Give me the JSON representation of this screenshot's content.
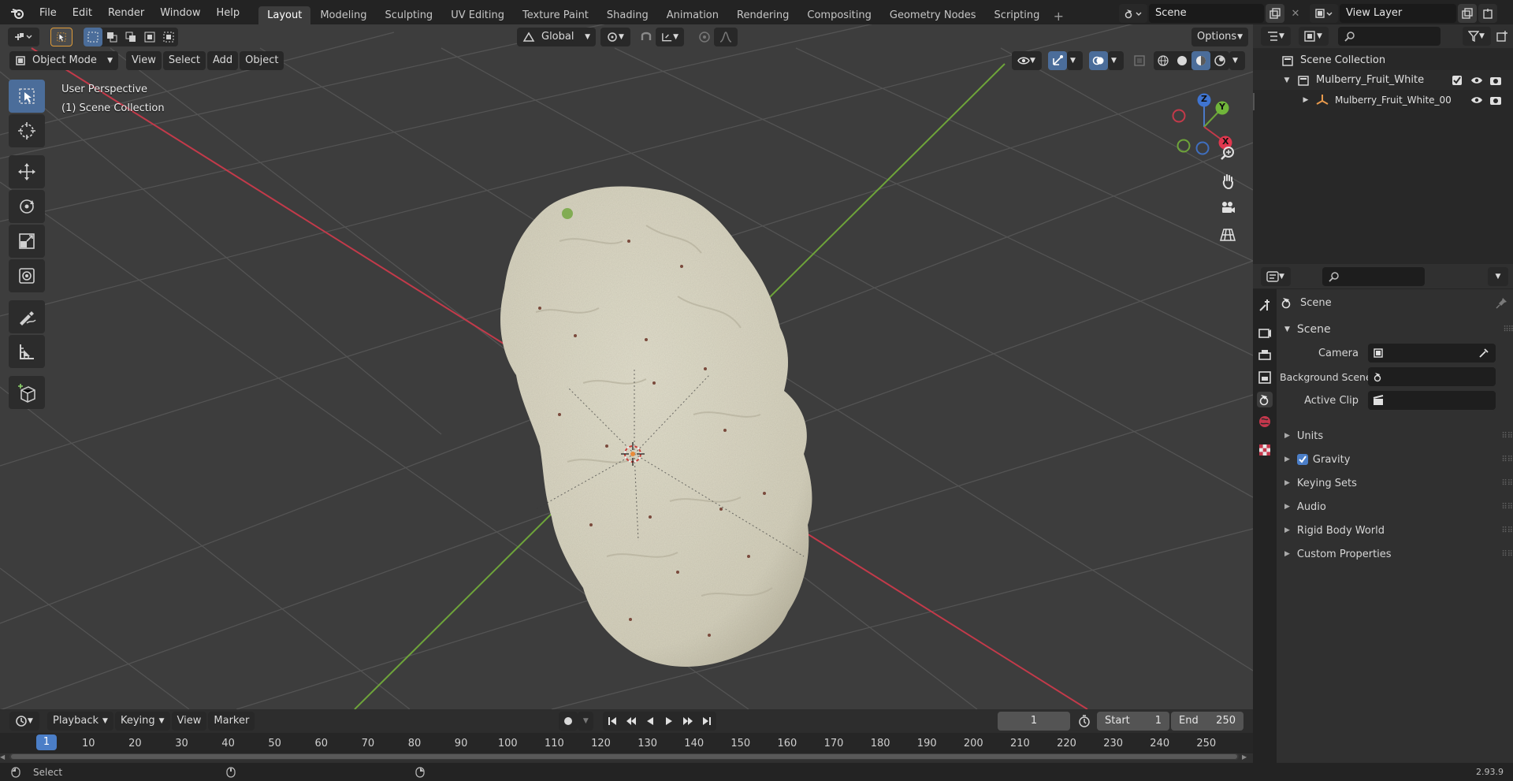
{
  "app": {
    "version": "2.93.9"
  },
  "topbar": {
    "menus": [
      "File",
      "Edit",
      "Render",
      "Window",
      "Help"
    ],
    "workspace_tabs": [
      "Layout",
      "Modeling",
      "Sculpting",
      "UV Editing",
      "Texture Paint",
      "Shading",
      "Animation",
      "Rendering",
      "Compositing",
      "Geometry Nodes",
      "Scripting"
    ],
    "active_tab": "Layout",
    "scene_field": "Scene",
    "view_layer_field": "View Layer"
  },
  "viewport": {
    "mode": "Object Mode",
    "header_menus": [
      "View",
      "Select",
      "Add",
      "Object"
    ],
    "orientation": "Global",
    "options_label": "Options",
    "overlay_line1": "User Perspective",
    "overlay_line2": "(1) Scene Collection",
    "gizmo_axes": {
      "x": "X",
      "y": "Y",
      "z": "Z"
    },
    "colors": {
      "background": "#3d3d3d",
      "grid": "#545454",
      "x_axis": "#c33a4a",
      "y_axis": "#6ea43a",
      "object": "#d9d6c4"
    }
  },
  "outliner": {
    "root": "Scene Collection",
    "collection": "Mulberry_Fruit_White",
    "object": "Mulberry_Fruit_White_00"
  },
  "properties": {
    "context_title": "Scene",
    "panel_title": "Scene",
    "fields": [
      {
        "label": "Camera",
        "value": ""
      },
      {
        "label": "Background Scene",
        "value": ""
      },
      {
        "label": "Active Clip",
        "value": ""
      }
    ],
    "sections": [
      "Units",
      "Gravity",
      "Keying Sets",
      "Audio",
      "Rigid Body World",
      "Custom Properties"
    ],
    "gravity_checked": true
  },
  "timeline": {
    "menus": [
      "Playback",
      "Keying",
      "View",
      "Marker"
    ],
    "current_frame": "1",
    "start_label": "Start",
    "start_value": "1",
    "end_label": "End",
    "end_value": "250",
    "ruler_frame": "1",
    "ticks": [
      "10",
      "20",
      "30",
      "40",
      "50",
      "60",
      "70",
      "80",
      "90",
      "100",
      "110",
      "120",
      "130",
      "140",
      "150",
      "160",
      "170",
      "180",
      "190",
      "200",
      "210",
      "220",
      "230",
      "240",
      "250"
    ]
  },
  "statusbar": {
    "left_label": "Select"
  }
}
